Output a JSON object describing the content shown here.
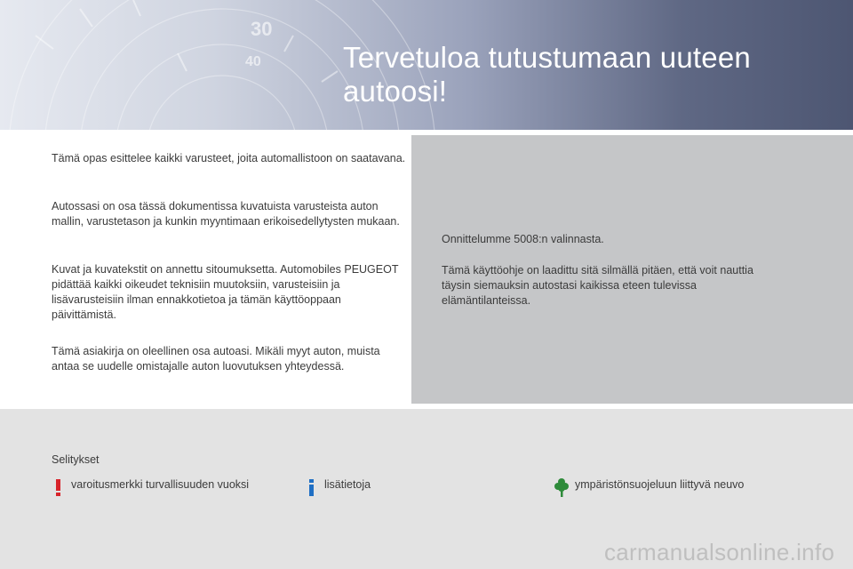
{
  "header": {
    "title": "Tervetuloa tutustumaan uuteen autoosi!",
    "gauge_numbers": [
      "30",
      "40"
    ]
  },
  "intro": {
    "p1": "Tämä opas esittelee kaikki varusteet, joita automallistoon on saatavana.",
    "p2": "Autossasi on osa tässä dokumentissa kuvatuista varusteista auton mallin, varustetason ja kunkin myyntimaan erikoisedellytysten mukaan.",
    "p3": "Kuvat ja kuvatekstit on annettu sitoumuksetta. Automobiles PEUGEOT pidättää kaikki oikeudet teknisiin muutoksiin, varusteisiin ja lisävarusteisiin ilman ennakkotietoa ja tämän käyttöoppaan päivittämistä.",
    "p4": "Tämä asiakirja on oleellinen osa autoasi. Mikäli myyt auton, muista antaa se uudelle omistajalle auton luovutuksen yhteydessä."
  },
  "welcome": {
    "p1": "Onnittelumme 5008:n valinnasta.",
    "p2": "Tämä käyttöohje on laadittu sitä silmällä pitäen, että voit nauttia täysin siemauksin autostasi kaikissa eteen tulevissa elämäntilanteissa."
  },
  "legend": {
    "heading": "Selitykset",
    "items": [
      {
        "icon": "exclamation-icon",
        "color": "#d8232a",
        "label": "varoitusmerkki turvallisuuden vuoksi"
      },
      {
        "icon": "info-icon",
        "color": "#1f6fc4",
        "label": "lisätietoja"
      },
      {
        "icon": "tree-icon",
        "color": "#2e8b3a",
        "label": "ympäristönsuojeluun liittyvä neuvo"
      }
    ]
  },
  "watermark": "carmanualsonline.info",
  "colors": {
    "banner_dark": "#4d5672",
    "panel_grey": "#c5c6c8",
    "legend_bg": "#e3e3e3"
  }
}
